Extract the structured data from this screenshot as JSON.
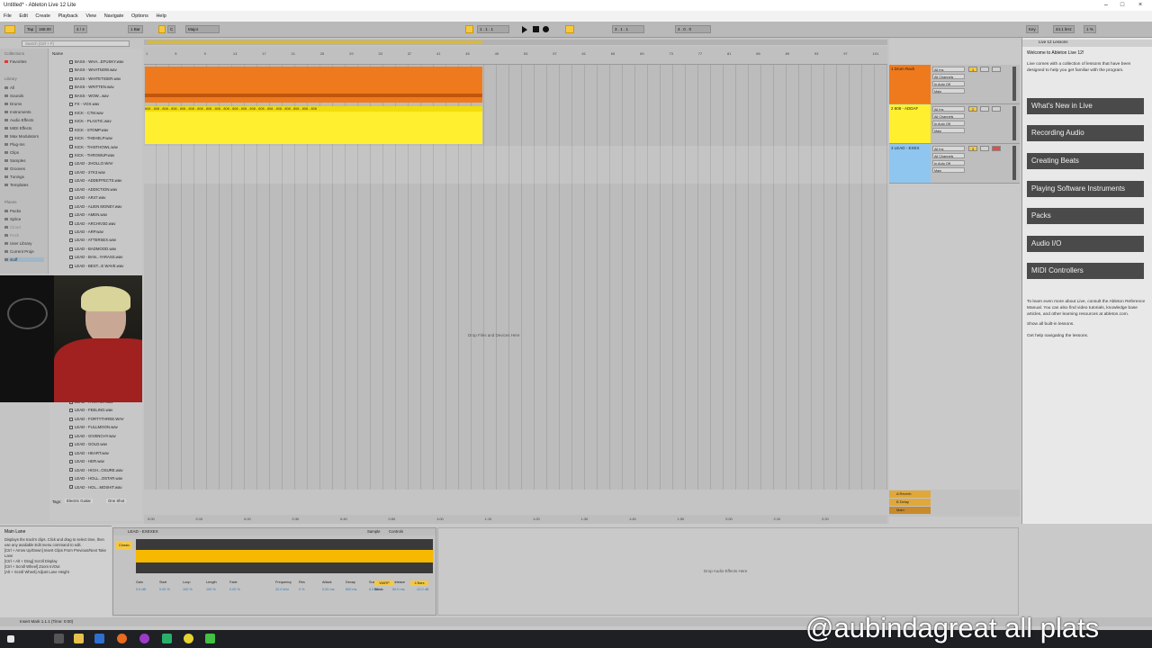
{
  "window": {
    "title": "Untitled* - Ableton Live 12 Lite",
    "controls": [
      "–",
      "□",
      "×"
    ]
  },
  "menu": [
    "File",
    "Edit",
    "Create",
    "Playback",
    "View",
    "Navigate",
    "Options",
    "Help"
  ],
  "transport": {
    "tap": "Tap",
    "tempo": "168.00",
    "sig": "4 / 4",
    "quant": "1 Bar",
    "scale_key": "C",
    "scale": "Major",
    "position": "1 . 1 . 1",
    "loop_start": "3 . 1 . 1",
    "loop_len": "4 . 0 . 0",
    "audio": "Key",
    "midi": "MIDI",
    "rate": "44.1 kHz",
    "cpu": "1 %"
  },
  "browser": {
    "search_placeholder": "Search (Ctrl + F)",
    "collections_label": "Collections",
    "favorites": "Favorites",
    "library_label": "Library",
    "library": [
      "All",
      "Sounds",
      "Drums",
      "Instruments",
      "Audio Effects",
      "MIDI Effects",
      "Max Modulators",
      "Plug-Ins",
      "Clips",
      "Samples",
      "Grooves",
      "Tunings",
      "Templates"
    ],
    "places_label": "Places",
    "places": [
      "Packs",
      "Splice",
      "Cloud",
      "Push",
      "User Library",
      "Current Proje",
      "stuff"
    ],
    "name_header": "Name",
    "files_top": [
      "BASS - WHA...EFUSKY.wav",
      "BASS - WHATNOW.wav",
      "BASS - WHITETIGER.wav",
      "BASS - WRITTEN.wav",
      "BASS - WOW...wav",
      "FX - VOX.wav",
      "KICK - C7M.wav",
      "KICK - PLASTIC.wav",
      "KICK - STOMP.wav",
      "KICK - THEHELP.wav",
      "KICK - THISTHOWL.wav",
      "KICK - THROWUP.wav",
      "LEAD - 2HOLLO.WAV",
      "LEAD - 27K3.wav",
      "LEAD - ADDEFFECTS.wav",
      "LEAD - ADDICTION.wav",
      "LEAD - AR47.wav",
      "LEAD - ALIEN MONEY.wav",
      "LEAD - AMEN.wav",
      "LEAD - ARCHIV3D.wav",
      "LEAD - ARP.wav",
      "LEAD - ATTERSEX.wav",
      "LEAD - BADMOOD.wav",
      "LEAD - BAN...YARASS.wav",
      "LEAD - BEST...E WAVE.wav"
    ],
    "files_bottom": [
      "LEAD - FANTASY.wav",
      "LEAD - FEELING.wav",
      "LEAD - FORTYTHREE.WAV",
      "LEAD - FULLMOON.wav",
      "LEAD - GIVENCHY.wav",
      "LEAD - GOLD.wav",
      "LEAD - HEART.wav",
      "LEAD - HER.wav",
      "LEAD - HIGH...OSURE.wav",
      "LEAD - HOLL...OSTAR.wav",
      "LEAD - HOL...MOSHIT.wav"
    ],
    "tags_label": "Tags:",
    "tag1": "Electric Guitar",
    "tag2": "One Shot"
  },
  "ruler_ticks": [
    "1",
    "5",
    "9",
    "13",
    "17",
    "21",
    "25",
    "29",
    "33",
    "37",
    "41",
    "45",
    "49",
    "53",
    "57",
    "61",
    "65",
    "69",
    "73",
    "77",
    "81",
    "85",
    "89",
    "93",
    "97",
    "101"
  ],
  "clip2_label": "808 - 808 - 808 - 808 - 808 - 808 - 808 - 808 - 808 - 808 - 808 - 808 - 808 - 808 - 808 - 808 - 808 - 808 - 808 - 808",
  "arrangement_drop": "Drop Files and Devices Here",
  "tracks": [
    {
      "name": "1 Drum Rack",
      "color": "#ef7a1d",
      "num": "1",
      "in": "All Ins",
      "ch": "All Channels",
      "mon": "In  Auto  Off",
      "out": "Main"
    },
    {
      "name": "2 808 - ADDAF",
      "color": "#ffef2e",
      "num": "2",
      "in": "All Ins",
      "ch": "All Channels",
      "mon": "In  Auto  Off",
      "out": "Main"
    },
    {
      "name": "3 LEAD - EXEX",
      "color": "#8fc6f0",
      "num": "3",
      "in": "All Ins",
      "ch": "All Channels",
      "mon": "In  Auto  Off",
      "out": "Main"
    }
  ],
  "returns": [
    "A Reverb",
    "B Delay",
    "Main"
  ],
  "time_marks": [
    "0:00",
    "0:10",
    "0:20",
    "0:30",
    "0:40",
    "0:50",
    "1:00",
    "1:10",
    "1:20",
    "1:30",
    "1:40",
    "1:50",
    "2:00",
    "2:10",
    "2:20"
  ],
  "lessons": {
    "header": "Live 12 Lessons",
    "welcome": "Welcome to Ableton Live 12!",
    "intro": "Live comes with a collection of lessons that have been designed to help you get familiar with the program.",
    "buttons": [
      "What's New in Live",
      "Recording Audio",
      "Creating Beats",
      "Playing Software Instruments",
      "Packs",
      "Audio I/O",
      "MIDI Controllers"
    ],
    "footer1": "To learn even more about Live, consult the Ableton Reference Manual. You can also find video tutorials, knowledge base articles, and other learning resources at ableton.com.",
    "footer2": "Show all built-in lessons.",
    "footer3": "Get help navigating the lessons."
  },
  "info": {
    "title": "Main Lane",
    "text": "Displays the track's clips. Click and drag to select time, then use any available Edit menu command to edit.\n[Ctrl + Arrow Up/Down] Insert Clips From Previous/Next Take Lane\n[Ctrl + Alt + Drag] Scroll Display\n[Ctrl + Scroll Wheel] Zoom In/Out\n[Alt + Scroll Wheel] Adjust Lane Height"
  },
  "clip_detail": {
    "name": "LEAD - EXEXEX",
    "tab_sample": "Sample",
    "tab_controls": "Controls",
    "labels": [
      "Gain",
      "Start",
      "Loop",
      "Length",
      "Fade",
      "Frequency",
      "Res",
      "Attack",
      "Decay",
      "Sustain",
      "Release",
      "Volume"
    ],
    "values": [
      "0.0 dB",
      "0.00 %",
      "100 %",
      "100 %",
      "0.00 %",
      "22.0 kHz",
      "0 %",
      "0.00 ms",
      "600 ms",
      "0.0 dB",
      "50.0 ms",
      "-12.0 dB"
    ],
    "mode": "Classic",
    "warp": "WARP",
    "beats": "Beats",
    "bars": "4 Bars"
  },
  "device_drop": "Drop Audio Effects Here",
  "status": "Insert Mark 1.1.1 (Time: 0:00)",
  "watermark": "@aubindagreat all plats",
  "colors": {
    "orange": "#ef7a1d",
    "yellow": "#ffef2e",
    "blue": "#8fc6f0",
    "lesson_btn": "#4a4a4a"
  }
}
